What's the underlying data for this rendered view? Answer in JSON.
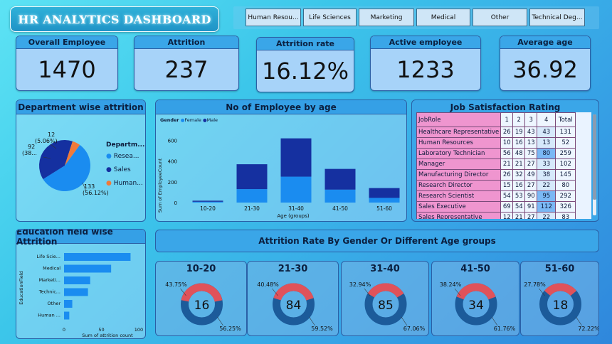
{
  "title": "HR ANALYTICS DASHBOARD",
  "slicer": [
    "Human Resou...",
    "Life Sciences",
    "Marketing",
    "Medical",
    "Other",
    "Technical Deg..."
  ],
  "kpis": [
    {
      "label": "Overall Employee",
      "value": "1470"
    },
    {
      "label": "Attrition",
      "value": "237"
    },
    {
      "label": "Attrition rate",
      "value": "16.12%"
    },
    {
      "label": "Active employee",
      "value": "1233"
    },
    {
      "label": "Average age",
      "value": "36.92"
    }
  ],
  "dept": {
    "title": "Department wise attrition",
    "legend_title": "Departm...",
    "legend": [
      "Resea...",
      "Sales",
      "Human..."
    ],
    "colors": [
      "#1a8cf0",
      "#1530a0",
      "#f07a3a"
    ],
    "labels": {
      "hr_count": "12",
      "hr_pct": "(5.06%)",
      "sales_count": "92",
      "sales_pct": "(38...",
      "rnd_count": "133",
      "rnd_pct": "(56.12%)"
    }
  },
  "age_chart": {
    "title": "No of Employee by age",
    "legend_title": "Gender",
    "legend": [
      "Female",
      "Male"
    ],
    "ylabel": "Sum of EmployeeCount",
    "xlabel": "Age (groups)",
    "yticks": [
      "600",
      "400",
      "200",
      "0"
    ],
    "categories": [
      "10-20",
      "21-30",
      "31-40",
      "41-50",
      "51-60"
    ]
  },
  "job": {
    "title": "Job Satisfaction Rating",
    "headers": [
      "JobRole",
      "1",
      "2",
      "3",
      "4",
      "Total"
    ],
    "rows": [
      [
        "Healthcare Representative",
        "26",
        "19",
        "43",
        "43",
        "131"
      ],
      [
        "Human Resources",
        "10",
        "16",
        "13",
        "13",
        "52"
      ],
      [
        "Laboratory Technician",
        "56",
        "48",
        "75",
        "80",
        "259"
      ],
      [
        "Manager",
        "21",
        "21",
        "27",
        "33",
        "102"
      ],
      [
        "Manufacturing Director",
        "26",
        "32",
        "49",
        "38",
        "145"
      ],
      [
        "Research Director",
        "15",
        "16",
        "27",
        "22",
        "80"
      ],
      [
        "Research Scientist",
        "54",
        "53",
        "90",
        "95",
        "292"
      ],
      [
        "Sales Executive",
        "69",
        "54",
        "91",
        "112",
        "326"
      ],
      [
        "Sales Representative",
        "12",
        "21",
        "27",
        "22",
        "83"
      ]
    ]
  },
  "edu": {
    "title": "Education field wise Attrition",
    "ylabel": "EducationField",
    "xlabel": "Sum of attrition count",
    "xticks": [
      "0",
      "50",
      "100"
    ],
    "categories": [
      "Life Scie...",
      "Medical",
      "Marketi...",
      "Technic...",
      "Other",
      "Human ..."
    ]
  },
  "gender_title": "Attrition Rate By Gender Or Different Age groups",
  "donuts": [
    {
      "label": "10-20",
      "center": "16",
      "top": "43.75%",
      "bottom": "56.25%"
    },
    {
      "label": "21-30",
      "center": "84",
      "top": "40.48%",
      "bottom": "59.52%"
    },
    {
      "label": "31-40",
      "center": "85",
      "top": "32.94%",
      "bottom": "67.06%"
    },
    {
      "label": "41-50",
      "center": "34",
      "top": "38.24%",
      "bottom": "61.76%"
    },
    {
      "label": "51-60",
      "center": "18",
      "top": "27.78%",
      "bottom": "72.22%"
    }
  ],
  "chart_data": [
    {
      "type": "pie",
      "title": "Department wise attrition",
      "categories": [
        "Research & Development",
        "Sales",
        "Human Resources"
      ],
      "values": [
        133,
        92,
        12
      ]
    },
    {
      "type": "bar",
      "title": "No of Employee by age",
      "categories": [
        "10-20",
        "21-30",
        "31-40",
        "41-50",
        "51-60"
      ],
      "series": [
        {
          "name": "Female",
          "values": [
            8,
            130,
            250,
            125,
            45
          ]
        },
        {
          "name": "Male",
          "values": [
            10,
            240,
            370,
            200,
            95
          ]
        }
      ],
      "ylim": [
        0,
        700
      ]
    },
    {
      "type": "bar",
      "title": "Education field wise Attrition",
      "categories": [
        "Life Scie...",
        "Medical",
        "Marketi...",
        "Technic...",
        "Other",
        "Human ..."
      ],
      "values": [
        89,
        63,
        35,
        32,
        11,
        7
      ],
      "xlim": [
        0,
        100
      ]
    },
    {
      "type": "pie",
      "title": "Attrition Rate By Gender Or Different Age groups",
      "categories": [
        "10-20",
        "21-30",
        "31-40",
        "41-50",
        "51-60"
      ],
      "series": [
        {
          "values": [
            43.75,
            40.48,
            32.94,
            38.24,
            27.78
          ]
        },
        {
          "values": [
            56.25,
            59.52,
            67.06,
            61.76,
            72.22
          ]
        }
      ]
    }
  ],
  "colors": {
    "female": "#1a8cf0",
    "male": "#1530a0",
    "donut_top": "#e0525a",
    "donut_bottom": "#1c5b9a"
  }
}
